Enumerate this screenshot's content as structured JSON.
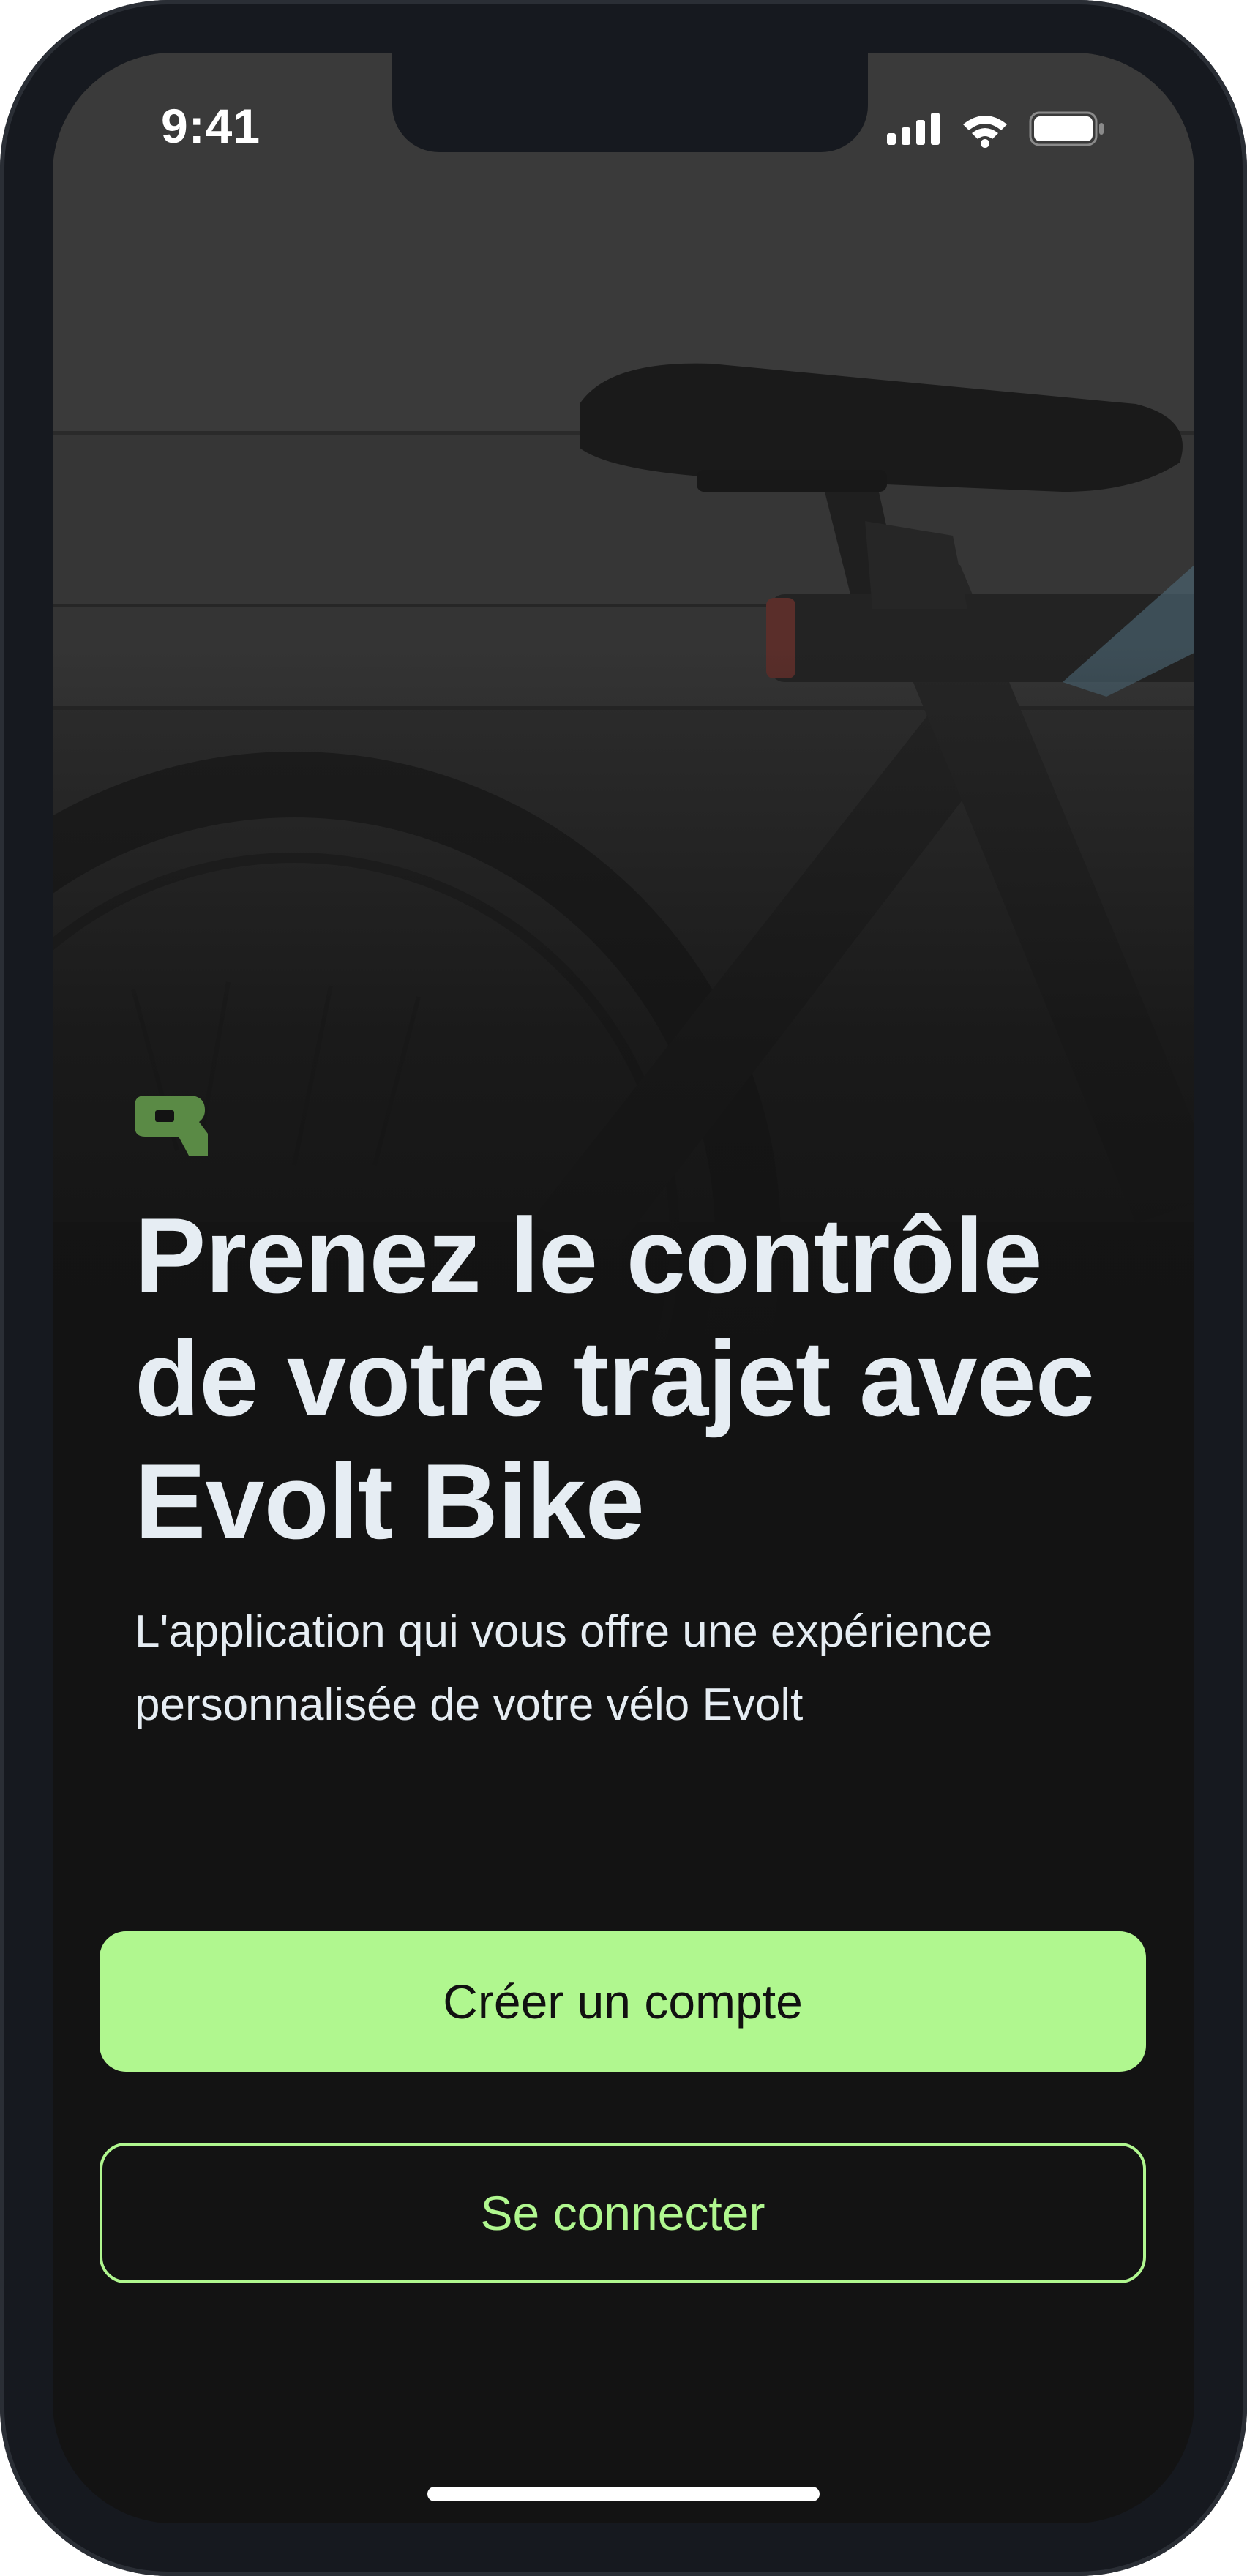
{
  "status_bar": {
    "time": "9:41",
    "icons": [
      "cellular-signal-icon",
      "wifi-icon",
      "battery-icon"
    ]
  },
  "background": {
    "image": "bike-photo"
  },
  "brand": {
    "logo": "evolt-logo-icon",
    "accent_color": "#b0f78f",
    "logo_color": "#5a8a45"
  },
  "main": {
    "headline": "Prenez le contrôle de votre trajet avec Evolt Bike",
    "subtitle": "L'application qui vous offre une expérience personnalisée de votre vélo Evolt"
  },
  "actions": {
    "create_account_label": "Créer un compte",
    "login_label": "Se connecter"
  },
  "colors": {
    "background": "#131313",
    "text": "#e6edf3",
    "primary_text": "#111111"
  }
}
